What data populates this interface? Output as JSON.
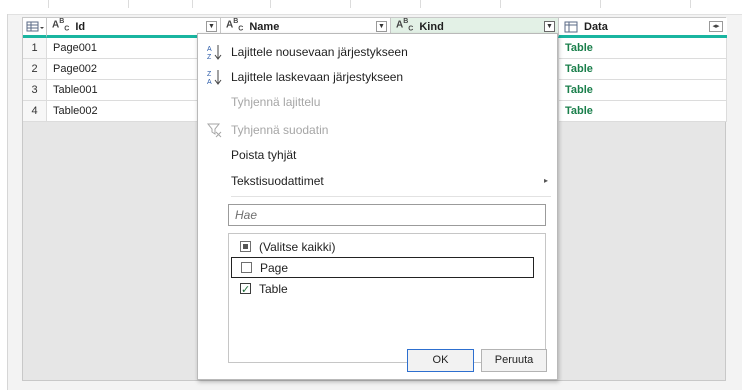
{
  "table": {
    "columns": [
      {
        "label": "Id",
        "type_icon": "text-type-icon"
      },
      {
        "label": "Name",
        "type_icon": "text-type-icon"
      },
      {
        "label": "Kind",
        "type_icon": "text-type-icon"
      },
      {
        "label": "Data",
        "type_icon": "table-type-icon"
      }
    ],
    "rows": [
      {
        "num": "1",
        "id": "Page001",
        "data": "Table"
      },
      {
        "num": "2",
        "id": "Page002",
        "data": "Table"
      },
      {
        "num": "3",
        "id": "Table001",
        "data": "Table"
      },
      {
        "num": "4",
        "id": "Table002",
        "data": "Table"
      }
    ],
    "type_icon_text": {
      "a": "A",
      "b": "B",
      "c": "C"
    },
    "accent_color": "#19b5a0",
    "data_text_color": "#1a7f4b"
  },
  "filter_menu": {
    "items": [
      {
        "label": "Lajittele nousevaan järjestykseen",
        "enabled": true,
        "icon": "sort-ascending-icon"
      },
      {
        "label": "Lajittele laskevaan järjestykseen",
        "enabled": true,
        "icon": "sort-descending-icon"
      },
      {
        "label": "Tyhjennä lajittelu",
        "enabled": false,
        "icon": ""
      },
      {
        "label": "Tyhjennä suodatin",
        "enabled": false,
        "icon": "clear-filter-icon"
      },
      {
        "label": "Poista tyhjät",
        "enabled": true,
        "icon": ""
      },
      {
        "label": "Tekstisuodattimet",
        "enabled": true,
        "icon": "",
        "submenu": true
      }
    ],
    "search": {
      "placeholder": "Hae",
      "value": ""
    },
    "options": [
      {
        "label": "(Valitse kaikki)",
        "state": "partial"
      },
      {
        "label": "Page",
        "state": "unchecked"
      },
      {
        "label": "Table",
        "state": "checked"
      }
    ],
    "ok_label": "OK",
    "cancel_label": "Peruuta"
  }
}
